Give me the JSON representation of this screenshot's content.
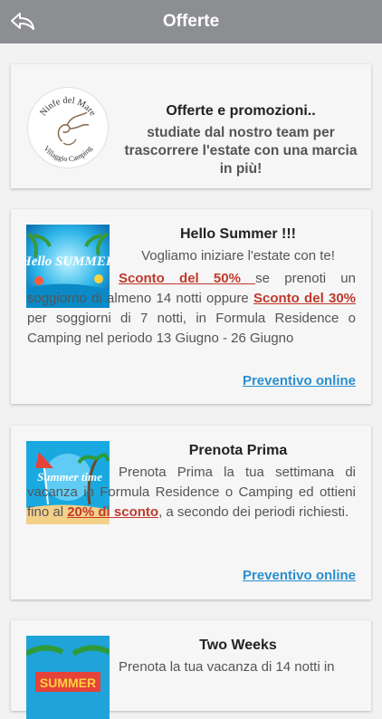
{
  "header": {
    "title": "Offerte",
    "back_icon": "back-arrow-icon"
  },
  "intro": {
    "logo_text_top": "Ninfe del Mare",
    "logo_text_bottom": "Villaggio Camping",
    "title": "Offerte e promozioni..",
    "text": "studiate dal nostro team per trascorrere l'estate con una marcia in più!"
  },
  "offers": [
    {
      "title": "Hello Summer !!!",
      "subtitle": "Vogliamo iniziare l'estate con te!",
      "highlight1": "Sconto del 50% ",
      "text1": " se prenoti un soggiorno di almeno 14 notti oppure ",
      "highlight2": "Sconto del 30%",
      "text2": " per soggiorni di 7 notti, in Formula Residence o Camping nel periodo 13 Giugno  -  26 Giugno",
      "link": "Preventivo online",
      "image_text": "Hello SUMMER"
    },
    {
      "title": "Prenota Prima",
      "text1": "Prenota Prima la tua settimana di vacanza in Formula Residence o Camping  ed ottieni fino al ",
      "highlight1": "20% di sconto",
      "text2": ", a secondo dei periodi richiesti.",
      "link": "Preventivo online",
      "image_text": "Summer time"
    },
    {
      "title": "Two Weeks",
      "text1": "Prenota la tua vacanza di 14 notti in",
      "image_text": "SUMMER"
    }
  ],
  "colors": {
    "header": "#8c8e91",
    "link": "#2a8fcf",
    "highlight": "#c0392b",
    "card": "#f6f6f6"
  }
}
